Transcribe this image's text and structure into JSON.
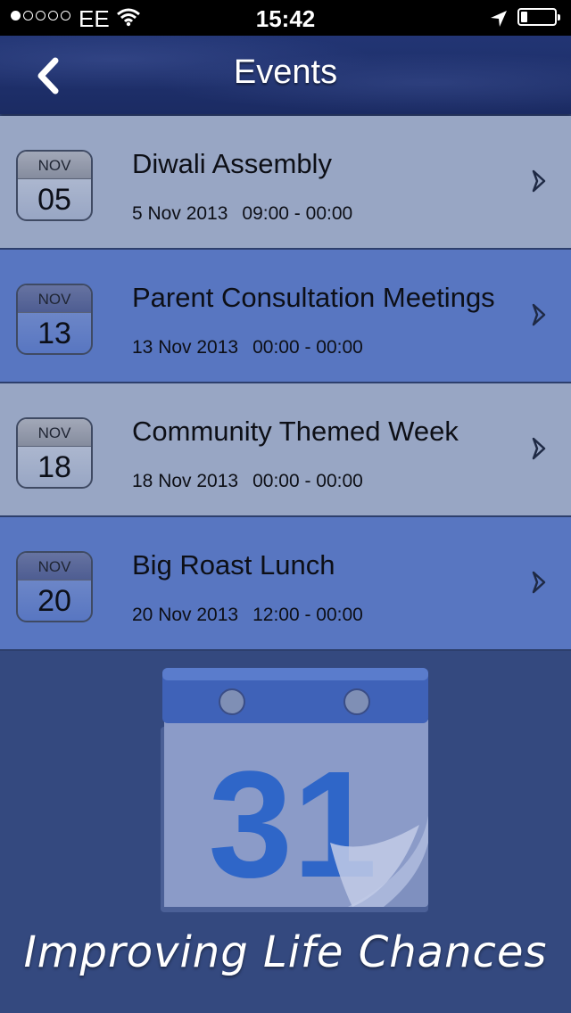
{
  "status_bar": {
    "carrier": "EE",
    "time": "15:42",
    "signal_bars_filled": 1,
    "signal_bars_total": 5,
    "battery_level": 0.2
  },
  "nav": {
    "title": "Events",
    "back_icon": "chevron-left-icon"
  },
  "events": [
    {
      "month": "NOV",
      "day": "05",
      "title": "Diwali Assembly",
      "date": "5 Nov 2013",
      "time": "09:00 - 00:00"
    },
    {
      "month": "NOV",
      "day": "13",
      "title": "Parent Consultation Meetings",
      "date": "13 Nov 2013",
      "time": "00:00 - 00:00"
    },
    {
      "month": "NOV",
      "day": "18",
      "title": "Community Themed Week",
      "date": "18 Nov 2013",
      "time": "00:00 - 00:00"
    },
    {
      "month": "NOV",
      "day": "20",
      "title": "Big Roast Lunch",
      "date": "20 Nov 2013",
      "time": "12:00 - 00:00"
    }
  ],
  "calendar_graphic": {
    "number": "31",
    "icon": "calendar-icon"
  },
  "footer": {
    "tagline": "Improving Life Chances"
  },
  "colors": {
    "nav_bar": "#1e2f6a",
    "row_light": "#98a6c4",
    "row_dark": "#5876c1",
    "background": "#34497f"
  }
}
